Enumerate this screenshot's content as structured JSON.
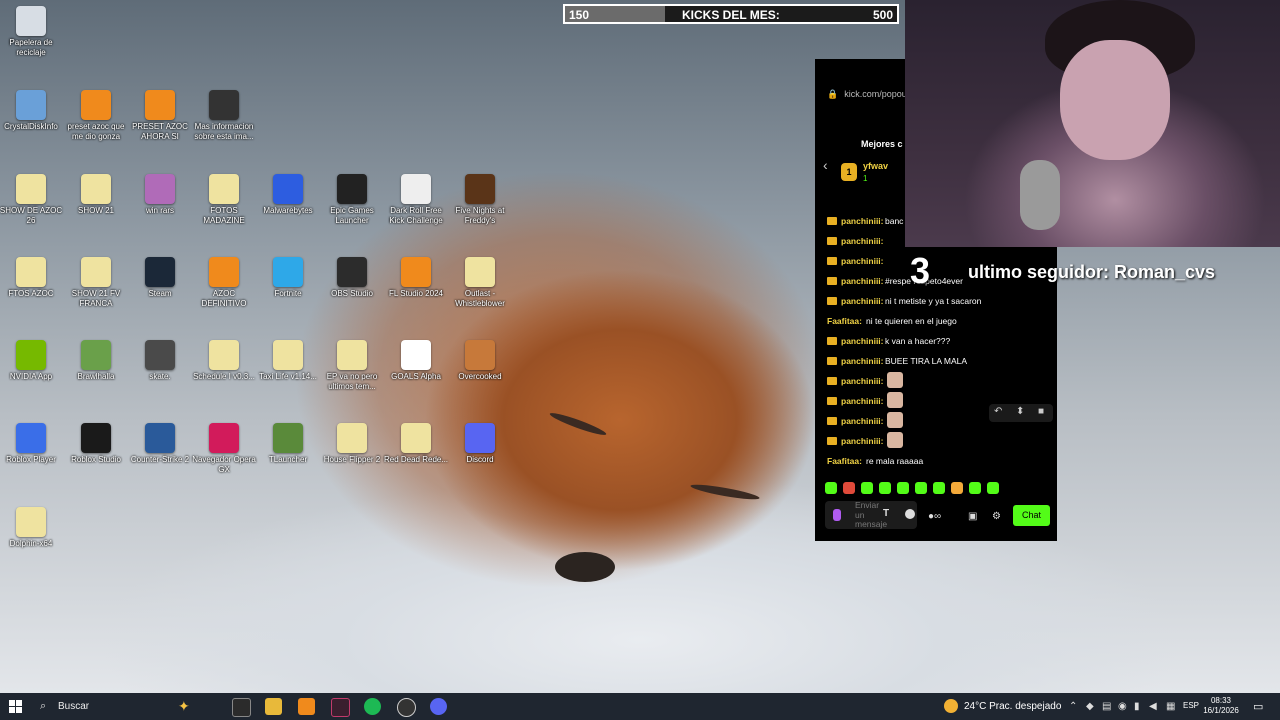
{
  "kicks": {
    "current": "150",
    "title": "KICKS DEL MES:",
    "goal": "500",
    "progress_fraction": 0.3
  },
  "overlay": {
    "countdown": "3",
    "last_follower": "ultimo seguidor: Roman_cvs"
  },
  "desktop_icons": [
    {
      "label": "Papelera de reciclaje",
      "icon": "recycle-bin-icon",
      "color": "#d7dde4"
    },
    {
      "label": "CrystalDiskInfo",
      "icon": "crystaldiskinfo-icon",
      "color": "#6aa0d8"
    },
    {
      "label": "preset azoc que me dio gonza",
      "icon": "fl-studio-icon",
      "color": "#f08a1c"
    },
    {
      "label": "PRESET AZOC AHORA SI",
      "icon": "fl-studio-icon",
      "color": "#f08a1c"
    },
    {
      "label": "Mas informacion sobre esta ima...",
      "icon": "info-icon",
      "color": "#333333"
    },
    {
      "label": "SHOW DE AZOC 26",
      "icon": "folder-icon",
      "color": "#efe3a0"
    },
    {
      "label": "SHOW 21",
      "icon": "folder-icon",
      "color": "#efe3a0"
    },
    {
      "label": "win rars",
      "icon": "winrar-icon",
      "color": "#b06bb8"
    },
    {
      "label": "FOTOS MADAZINE",
      "icon": "folder-icon",
      "color": "#efe3a0"
    },
    {
      "label": "Malwarebytes",
      "icon": "malwarebytes-icon",
      "color": "#2d5de0"
    },
    {
      "label": "Epic Games Launcher",
      "icon": "epic-games-icon",
      "color": "#222222"
    },
    {
      "label": "Dark Roll Free Kick Challenge",
      "icon": "football-icon",
      "color": "#eeeeee"
    },
    {
      "label": "Five Nights at Freddy's",
      "icon": "fnaf-icon",
      "color": "#5a3418"
    },
    {
      "label": "FTOS AZOC",
      "icon": "folder-icon",
      "color": "#efe3a0"
    },
    {
      "label": "SHOW 21 FV FRANCA",
      "icon": "folder-icon",
      "color": "#efe3a0"
    },
    {
      "label": "Steam",
      "icon": "steam-icon",
      "color": "#1b2838"
    },
    {
      "label": "AZOC DEFINITIVO",
      "icon": "fl-studio-icon",
      "color": "#f08a1c"
    },
    {
      "label": "Fortnite",
      "icon": "fortnite-icon",
      "color": "#2ea8e8"
    },
    {
      "label": "OBS Studio",
      "icon": "obs-icon",
      "color": "#2c2c2c"
    },
    {
      "label": "FL Studio 2024",
      "icon": "fl-studio-icon",
      "color": "#f08a1c"
    },
    {
      "label": "Outlast - Whistleblower",
      "icon": "folder-icon",
      "color": "#efe3a0"
    },
    {
      "label": "NVIDIA App",
      "icon": "nvidia-icon",
      "color": "#76b900"
    },
    {
      "label": "Brawlhalla",
      "icon": "brawlhalla-icon",
      "color": "#6aa04a"
    },
    {
      "label": "skate.",
      "icon": "skate-icon",
      "color": "#4a4a4a"
    },
    {
      "label": "Schedule I v0.3...",
      "icon": "folder-icon",
      "color": "#efe3a0"
    },
    {
      "label": "Taxi Life v1.14...",
      "icon": "folder-icon",
      "color": "#efe3a0"
    },
    {
      "label": "EP va no pero ultimos tem...",
      "icon": "folder-icon",
      "color": "#efe3a0"
    },
    {
      "label": "GOALS Alpha",
      "icon": "goals-icon",
      "color": "#ffffff"
    },
    {
      "label": "Overcooked",
      "icon": "overcooked-icon",
      "color": "#c7793a"
    },
    {
      "label": "Roblox Player",
      "icon": "roblox-icon",
      "color": "#3a6ee8"
    },
    {
      "label": "Roblox Studio",
      "icon": "roblox-studio-icon",
      "color": "#1a1a1a"
    },
    {
      "label": "Counter-Strike 2",
      "icon": "cs2-icon",
      "color": "#2a5a9a"
    },
    {
      "label": "Navegador Opera GX",
      "icon": "opera-gx-icon",
      "color": "#d21b5b"
    },
    {
      "label": "TLauncher",
      "icon": "minecraft-icon",
      "color": "#5a8a3a"
    },
    {
      "label": "House Flipper 2",
      "icon": "folder-icon",
      "color": "#efe3a0"
    },
    {
      "label": "Red Dead Rede...",
      "icon": "folder-icon",
      "color": "#efe3a0"
    },
    {
      "label": "Discord",
      "icon": "discord-icon",
      "color": "#5865f2"
    },
    {
      "label": "Dolphin-x64",
      "icon": "folder-icon",
      "color": "#efe3a0"
    }
  ],
  "chat": {
    "url": "kick.com/popou",
    "header": "Mejores c",
    "top_gifter": {
      "rank": "1",
      "user": "yfwav",
      "count": "1"
    },
    "messages": [
      {
        "user": "panchiniii:",
        "user_color": "#f0d245",
        "crown": true,
        "text": "banc",
        "emote": false
      },
      {
        "user": "panchiniii:",
        "user_color": "#f0d245",
        "crown": true,
        "text": "",
        "emote": false
      },
      {
        "user": "panchiniii:",
        "user_color": "#f0d245",
        "crown": true,
        "text": "",
        "emote": false
      },
      {
        "user": "panchiniii:",
        "user_color": "#f0d245",
        "crown": true,
        "text": "#respe respeto4ever",
        "emote": false
      },
      {
        "user": "panchiniii:",
        "user_color": "#f0d245",
        "crown": true,
        "text": "ni t metiste y ya t sacaron",
        "emote": false
      },
      {
        "user": "Faafitaa:",
        "user_color": "#f0d245",
        "crown": false,
        "text": "ni te quieren en el juego",
        "emote": false
      },
      {
        "user": "panchiniii:",
        "user_color": "#f0d245",
        "crown": true,
        "text": "k van a hacer???",
        "emote": false
      },
      {
        "user": "panchiniii:",
        "user_color": "#f0d245",
        "crown": true,
        "text": "BUEE TIRA LA MALA",
        "emote": false
      },
      {
        "user": "panchiniii:",
        "user_color": "#f0d245",
        "crown": true,
        "text": "",
        "emote": true
      },
      {
        "user": "panchiniii:",
        "user_color": "#f0d245",
        "crown": true,
        "text": "",
        "emote": true
      },
      {
        "user": "panchiniii:",
        "user_color": "#f0d245",
        "crown": true,
        "text": "",
        "emote": true
      },
      {
        "user": "panchiniii:",
        "user_color": "#f0d245",
        "crown": true,
        "text": "",
        "emote": true
      },
      {
        "user": "Faafitaa:",
        "user_color": "#f0d245",
        "crown": false,
        "text": "re mala  raaaaa",
        "emote": false
      }
    ],
    "input_placeholder": "Enviar un mensaje",
    "send_label": "Chat",
    "accent": "#53fc18"
  },
  "taskbar": {
    "search_placeholder": "Buscar",
    "weather": "24°C  Prac. despejado",
    "language": "ESP",
    "time": "08:33",
    "date": "16/1/2026",
    "background": "#1f2630"
  }
}
